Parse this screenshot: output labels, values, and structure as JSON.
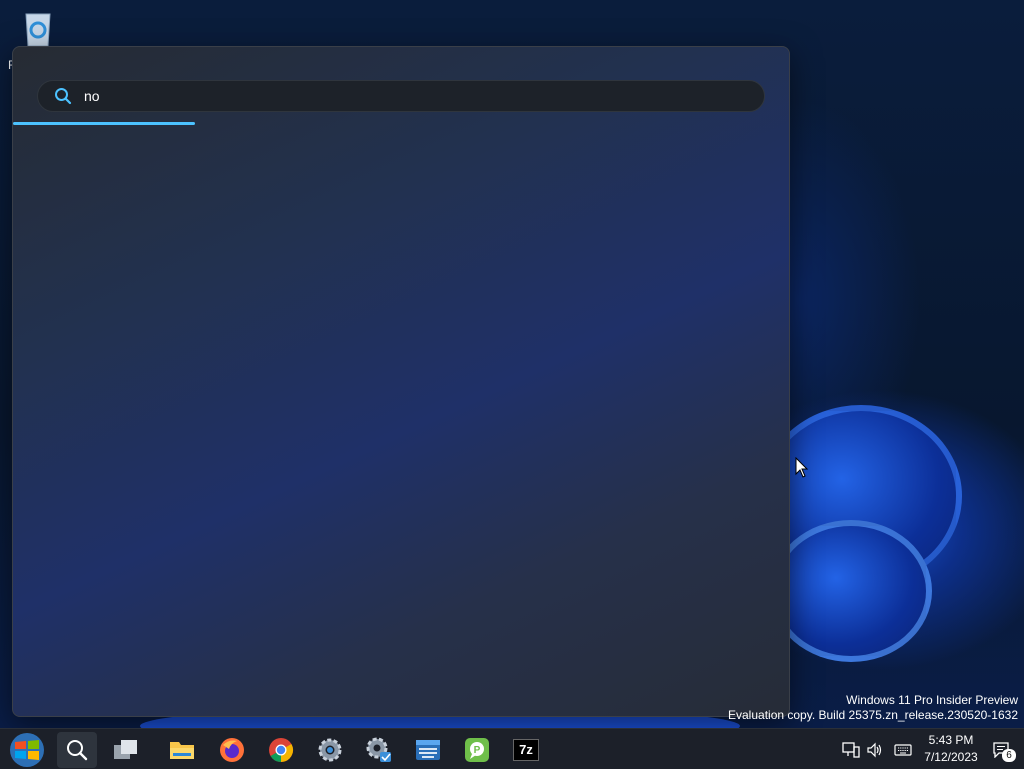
{
  "desktop": {
    "recycle_bin_label": "R"
  },
  "search_flyout": {
    "query": "no",
    "progress_fraction": 0.235
  },
  "watermark": {
    "line1": "Windows 11 Pro Insider Preview",
    "line2": "Evaluation copy. Build 25375.zn_release.230520-1632"
  },
  "taskbar": {
    "items": [
      {
        "name": "start",
        "icon": "windows-logo-icon"
      },
      {
        "name": "search",
        "icon": "search-icon"
      },
      {
        "name": "task-view",
        "icon": "task-view-icon"
      },
      {
        "name": "file-explorer",
        "icon": "folder-icon"
      },
      {
        "name": "firefox",
        "icon": "firefox-icon"
      },
      {
        "name": "chrome",
        "icon": "chrome-icon"
      },
      {
        "name": "settings",
        "icon": "gear-icon"
      },
      {
        "name": "control-settings",
        "icon": "gear-check-icon"
      },
      {
        "name": "on-screen-keyboard",
        "icon": "keyboard-app-icon"
      },
      {
        "name": "chat-app",
        "icon": "chat-icon"
      },
      {
        "name": "7zip",
        "icon": "7zip-icon",
        "label": "7z"
      }
    ],
    "tray": {
      "time": "5:43 PM",
      "date": "7/12/2023",
      "notification_count": "6"
    }
  }
}
